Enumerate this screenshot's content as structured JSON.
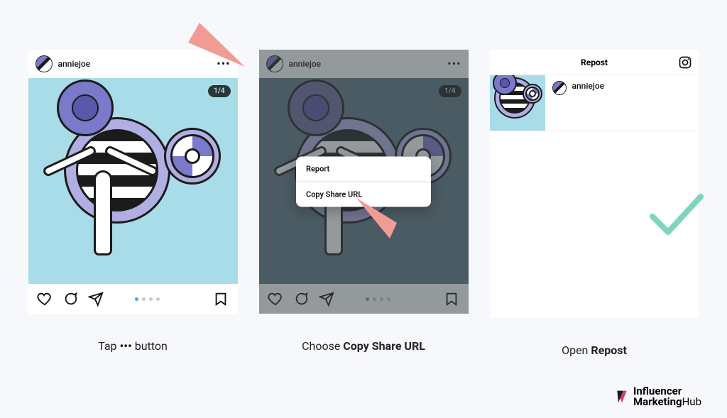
{
  "steps": {
    "step1": {
      "username": "anniejoe",
      "counter": "1/4",
      "caption_prefix": "Tap ",
      "caption_dots": "•••",
      "caption_suffix": " button"
    },
    "step2": {
      "username": "anniejoe",
      "counter": "1/4",
      "popup": {
        "report": "Report",
        "copy": "Copy Share URL"
      },
      "caption_prefix": "Choose ",
      "caption_bold": "Copy Share URL"
    },
    "step3": {
      "header_title": "Repost",
      "username": "anniejoe",
      "caption_prefix": "Open ",
      "caption_bold": "Repost"
    }
  },
  "brand": {
    "line1": "Influencer",
    "line2_a": "Marketing",
    "line2_b": "Hub"
  }
}
